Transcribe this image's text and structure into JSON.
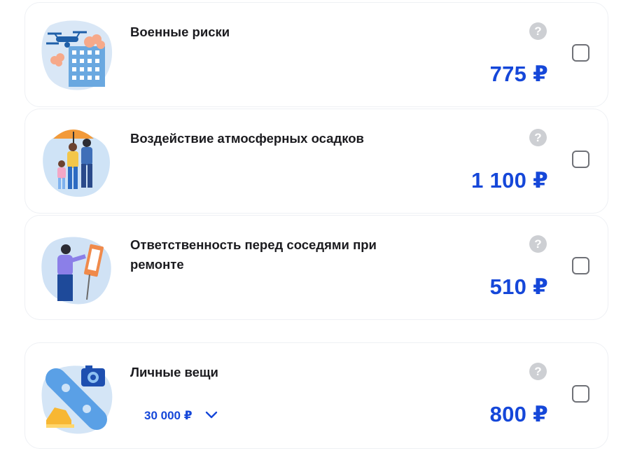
{
  "cards": [
    {
      "title": "Военные риски",
      "price": "775 ₽",
      "help": "?"
    },
    {
      "title": "Воздействие атмосферных осадков",
      "price": "1 100 ₽",
      "help": "?"
    },
    {
      "title": "Ответственность перед соседями при ремонте",
      "price": "510 ₽",
      "help": "?"
    },
    {
      "title": "Личные вещи",
      "price": "800 ₽",
      "help": "?",
      "amount": "30 000 ₽"
    }
  ],
  "colors": {
    "accent": "#1547d9",
    "title": "#1b1b1f",
    "help_bg": "#cdcfd3",
    "checkbox_border": "#6f7177",
    "card_border": "#eef0f4"
  },
  "icons": [
    "drone-building-icon",
    "umbrella-family-icon",
    "neighbor-renovation-icon",
    "snowboard-camera-sneakers-icon",
    "help-icon",
    "chevron-down-icon"
  ]
}
